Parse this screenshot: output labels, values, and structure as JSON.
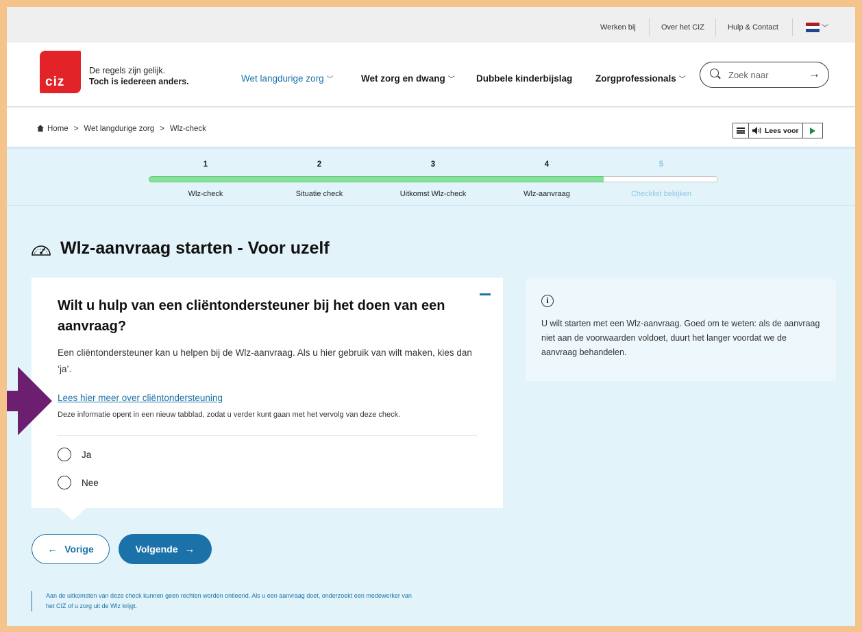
{
  "utility_nav": {
    "items": [
      "Werken bij",
      "Over het CIZ",
      "Hulp & Contact"
    ],
    "language_icon": "netherlands-flag-icon",
    "flag_colors": [
      "#ae1c28",
      "#ffffff",
      "#21468b"
    ]
  },
  "header": {
    "logo_text": "ciz",
    "tagline_line1": "De regels zijn gelijk.",
    "tagline_line2": "Toch is iedereen anders.",
    "nav": [
      {
        "label": "Wet langdurige zorg",
        "active": true
      },
      {
        "label": "Wet zorg en dwang",
        "active": false
      },
      {
        "label": "Dubbele kinderbijslag",
        "active": false
      },
      {
        "label": "Zorgprofessionals",
        "active": false
      }
    ],
    "search_placeholder": "Zoek naar"
  },
  "breadcrumb": {
    "items": [
      "Home",
      "Wet langdurige zorg",
      "Wlz-check"
    ]
  },
  "read_aloud": {
    "label": "Lees voor"
  },
  "stepper": {
    "current_step": 5,
    "steps": [
      {
        "number": "1",
        "label": "Wlz-check"
      },
      {
        "number": "2",
        "label": "Situatie check"
      },
      {
        "number": "3",
        "label": "Uitkomst Wlz-check"
      },
      {
        "number": "4",
        "label": "Wlz-aanvraag"
      },
      {
        "number": "5",
        "label": "Checklist bekijken"
      }
    ]
  },
  "page_title": "Wlz-aanvraag starten - Voor uzelf",
  "question": {
    "title": "Wilt u hulp van een cliëntondersteuner bij het doen van een aanvraag?",
    "description": "Een cliëntondersteuner kan u helpen bij de Wlz-aanvraag. Als u hier gebruik van wilt maken, kies dan ‘ja’.",
    "link_text": "Lees hier meer over cliëntondersteuning",
    "link_note": "Deze informatie opent in een nieuw tabblad, zodat u verder kunt gaan met het vervolg van deze check.",
    "options": [
      "Ja",
      "Nee"
    ]
  },
  "info_panel": {
    "text": "U wilt starten met een Wlz-aanvraag. Goed om te weten: als de aanvraag niet aan de voorwaarden voldoet, duurt het langer voordat we de aanvraag behandelen."
  },
  "buttons": {
    "previous": "Vorige",
    "next": "Volgende"
  },
  "disclaimer": "Aan de uitkomsten van deze check kunnen geen rechten worden ontleend. Als u een aanvraag doet, onderzoekt een medewerker van het CIZ of u zorg uit de Wlz krijgt.",
  "colors": {
    "brand_red": "#e22429",
    "primary_blue": "#1a72a8",
    "progress_green": "#86e29a",
    "annotation_purple": "#6b1f6e"
  }
}
